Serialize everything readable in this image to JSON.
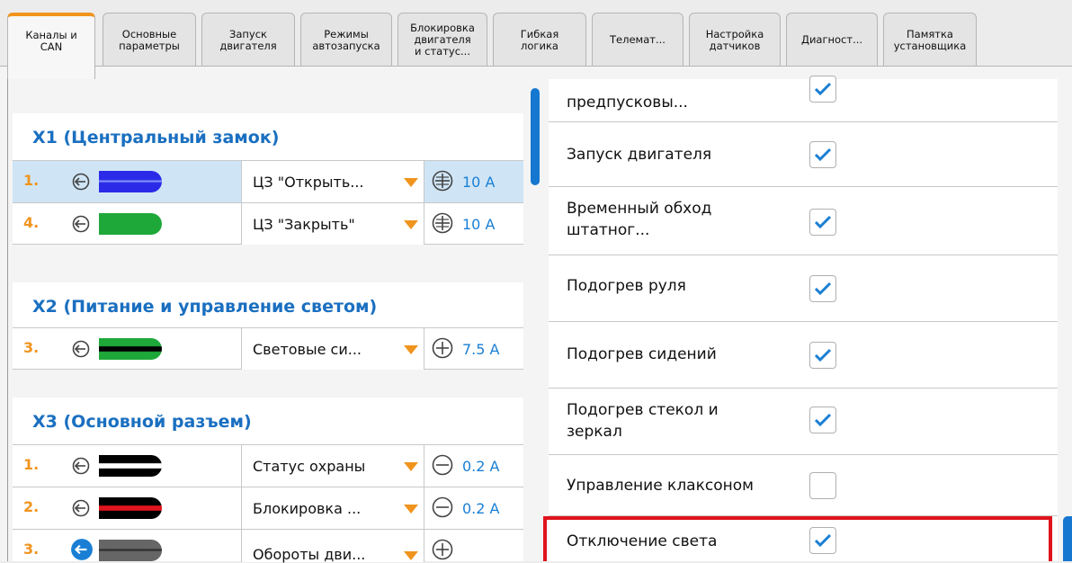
{
  "tabs": [
    {
      "label": "Каналы и\nCAN",
      "active": true
    },
    {
      "label": "Основные\nпараметры"
    },
    {
      "label": "Запуск\nдвигателя"
    },
    {
      "label": "Режимы\nавтозапуска"
    },
    {
      "label": "Блокировка\nдвигателя\nи статус..."
    },
    {
      "label": "Гибкая\nлогика"
    },
    {
      "label": "Телемат..."
    },
    {
      "label": "Настройка\nдатчиков"
    },
    {
      "label": "Диагност..."
    },
    {
      "label": "Памятка\nустановщика"
    }
  ],
  "groups": [
    {
      "title": "X1 (Центральный замок)"
    },
    {
      "title": "X2 (Питание и управление светом)"
    },
    {
      "title": "X3 (Основной разъем)"
    }
  ],
  "channels": [
    {
      "num": "1.",
      "wire_colors": [
        "#2a2ae8",
        "#ffffff"
      ],
      "function": "ЦЗ \"Открыть...",
      "sign": "plus",
      "current": "10 A",
      "selected": true
    },
    {
      "num": "4.",
      "wire_colors": [
        "#1fa83a",
        "#1fa83a"
      ],
      "function": "ЦЗ \"Закрыть\"",
      "sign": "plus",
      "current": "10 A"
    },
    {
      "num": "3.",
      "wire_colors": [
        "#1fa83a",
        "#000000"
      ],
      "function": "Световые си...",
      "sign": "plus",
      "current": "7.5 A"
    },
    {
      "num": "1.",
      "wire_colors": [
        "#000000",
        "#ffffff"
      ],
      "function": "Статус охраны",
      "sign": "minus",
      "current": "0.2 A"
    },
    {
      "num": "2.",
      "wire_colors": [
        "#000000",
        "#e0141c"
      ],
      "function": "Блокировка ...",
      "sign": "minus",
      "current": "0.2 A"
    },
    {
      "num": "3.",
      "wire_colors": [
        "#555555",
        "#555555"
      ],
      "function": "Обороты дви...",
      "sign": "plus",
      "current": ""
    }
  ],
  "functions": [
    {
      "label": "предпусковы...",
      "checked": true
    },
    {
      "label": "Запуск двигателя",
      "checked": true
    },
    {
      "label": "Временный обход штатног...",
      "checked": true
    },
    {
      "label": "Подогрев руля",
      "checked": true
    },
    {
      "label": "Подогрев сидений",
      "checked": true
    },
    {
      "label": "Подогрев стекол и зеркал",
      "checked": true
    },
    {
      "label": "Управление клаксоном",
      "checked": false
    },
    {
      "label": "Отключение света",
      "checked": true
    }
  ],
  "colors": {
    "accent": "#f0941e",
    "blue": "#1a6fc0",
    "highlight": "#e0141c"
  }
}
